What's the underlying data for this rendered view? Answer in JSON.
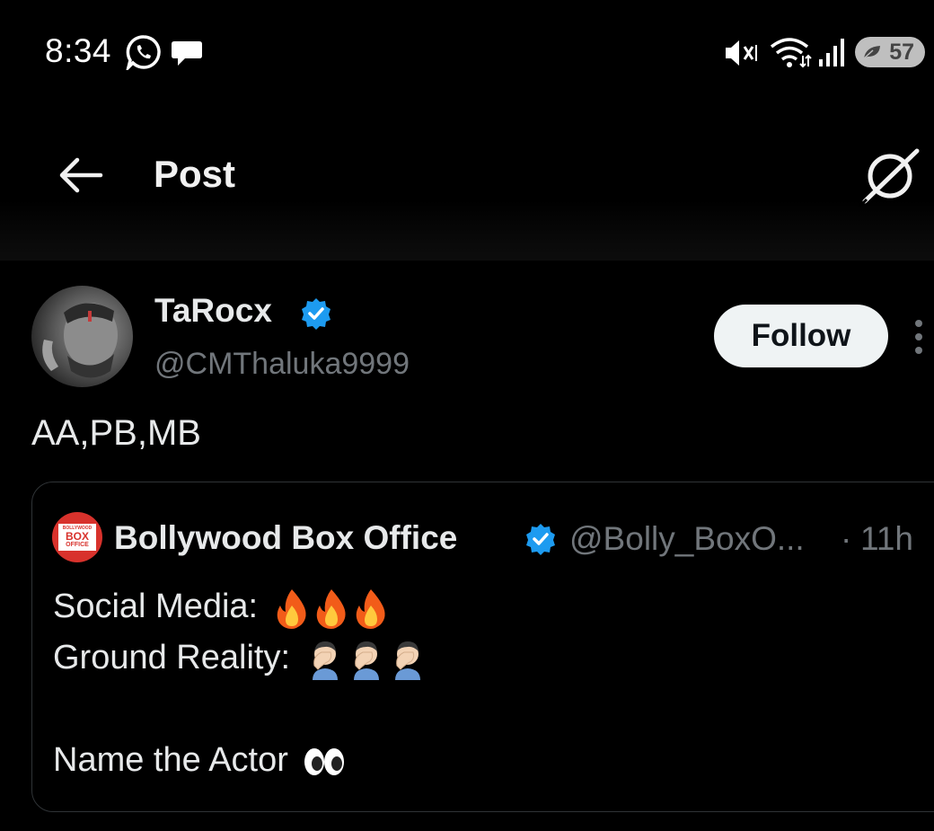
{
  "status_bar": {
    "time": "8:34",
    "battery_level": "57",
    "icons": [
      "whatsapp-icon",
      "chat-bubble-icon",
      "vibrate-off-icon",
      "wifi-icon",
      "cell-signal-icon",
      "battery-saver-leaf-icon"
    ]
  },
  "header": {
    "title": "Post",
    "back_icon": "arrow-left-icon",
    "grok_icon": "grok-icon"
  },
  "post": {
    "author": {
      "display_name": "TaRocx",
      "handle": "@CMThaluka9999",
      "verified": true
    },
    "follow_label": "Follow",
    "text": "AA,PB,MB"
  },
  "quoted_post": {
    "author": {
      "display_name": "Bollywood Box Office",
      "handle": "@Bolly_BoxO...",
      "verified": true,
      "avatar_text": [
        "BOLLYWOOD",
        "BOX",
        "OFFICE"
      ]
    },
    "separator": "·",
    "time": "11h",
    "lines": [
      {
        "text": "Social Media:",
        "emojis": [
          "fire",
          "fire",
          "fire"
        ]
      },
      {
        "text": "Ground Reality:",
        "emojis": [
          "facepalm",
          "facepalm",
          "facepalm"
        ]
      },
      {
        "text": "Name the Actor",
        "emojis": [
          "eyes"
        ]
      }
    ]
  },
  "colors": {
    "background": "#000000",
    "primary_text": "#e7e9ea",
    "secondary_text": "#71767b",
    "verified_blue": "#1d9bf0",
    "follow_button_bg": "#eff3f4",
    "border": "#2f3336"
  }
}
